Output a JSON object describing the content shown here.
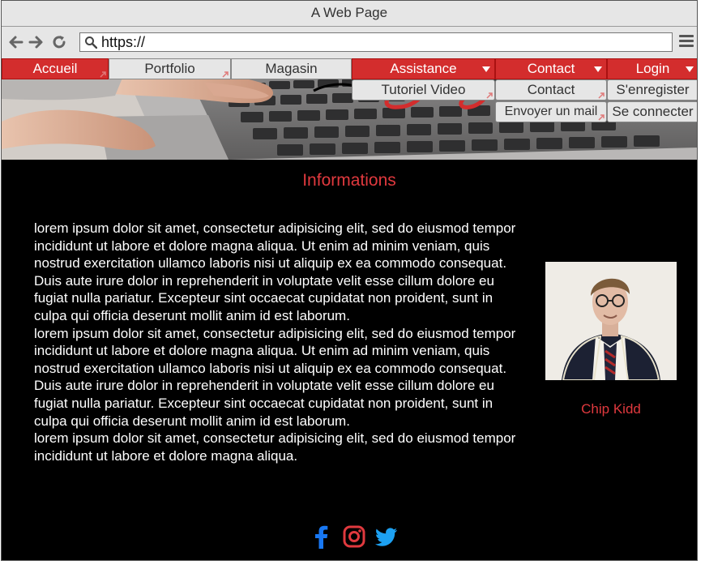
{
  "window": {
    "title": "A Web Page"
  },
  "browser": {
    "url": "https://"
  },
  "nav": {
    "items": [
      {
        "label": "Accueil"
      },
      {
        "label": "Portfolio"
      },
      {
        "label": "Magasin"
      },
      {
        "label": "Assistance"
      },
      {
        "label": "Contact"
      },
      {
        "label": "Login"
      }
    ],
    "assistance_sub": [
      "Tutoriel Video"
    ],
    "contact_sub": [
      "Contact",
      "Envoyer un mail"
    ],
    "login_sub": [
      "S'enregister",
      "Se connecter"
    ]
  },
  "main": {
    "heading": "Informations",
    "paragraphs": [
      "lorem ipsum dolor sit amet, consectetur adipisicing elit, sed do eiusmod tempor incididunt ut labore et dolore magna aliqua. Ut enim ad minim veniam, quis nostrud exercitation ullamco laboris nisi ut aliquip ex ea commodo consequat. Duis aute irure dolor in reprehenderit in voluptate velit esse cillum dolore eu fugiat nulla pariatur. Excepteur sint occaecat cupidatat non proident, sunt in culpa qui officia deserunt mollit anim id est laborum.",
      "lorem ipsum dolor sit amet, consectetur adipisicing elit, sed do eiusmod tempor incididunt ut labore et dolore magna aliqua. Ut enim ad minim veniam, quis nostrud exercitation ullamco laboris nisi ut aliquip ex ea commodo consequat. Duis aute irure dolor in reprehenderit in voluptate velit esse cillum dolore eu fugiat nulla pariatur. Excepteur sint occaecat cupidatat non proident, sunt in culpa qui officia deserunt mollit anim id est laborum.",
      "lorem ipsum dolor sit amet, consectetur adipisicing elit, sed do eiusmod tempor incididunt ut labore et dolore magna aliqua."
    ],
    "profile": {
      "name": "Chip Kidd"
    }
  },
  "social": {
    "icons": [
      "facebook-icon",
      "instagram-icon",
      "twitter-icon"
    ],
    "colors": {
      "facebook": "#1877f2",
      "instagram": "#e0393e",
      "twitter": "#1da1f2"
    }
  },
  "colors": {
    "accent": "#d32d2d",
    "heading": "#e0393e",
    "chrome": "#e6e6e6"
  }
}
